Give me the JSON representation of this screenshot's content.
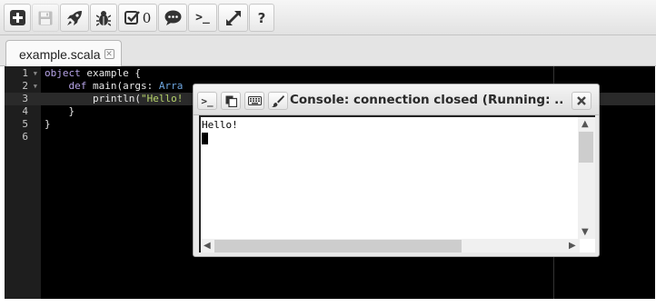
{
  "toolbar": {
    "buttons": [
      {
        "icon": "plus-square-icon"
      },
      {
        "icon": "save-icon",
        "disabled": true
      },
      {
        "icon": "rocket-icon"
      },
      {
        "icon": "bug-icon"
      },
      {
        "icon": "checkbox-icon",
        "count": "0"
      },
      {
        "icon": "speech-bubble-icon"
      },
      {
        "icon": "terminal-icon",
        "text": ">_"
      },
      {
        "icon": "expand-icon"
      },
      {
        "icon": "help-icon",
        "text": "?"
      }
    ]
  },
  "tabs": [
    {
      "label": "example.scala",
      "active": true
    }
  ],
  "editor": {
    "line_numbers": [
      "1",
      "2",
      "3",
      "4",
      "5",
      "6"
    ],
    "active_line": 3,
    "lines": [
      [
        {
          "t": "kw",
          "s": "object"
        },
        {
          "t": "plain",
          "s": " example {"
        }
      ],
      [
        {
          "t": "plain",
          "s": "    "
        },
        {
          "t": "kw",
          "s": "def"
        },
        {
          "t": "plain",
          "s": " main(args: "
        },
        {
          "t": "typ",
          "s": "Arra"
        }
      ],
      [
        {
          "t": "plain",
          "s": "        println("
        },
        {
          "t": "str",
          "s": "\"Hello!"
        }
      ],
      [
        {
          "t": "plain",
          "s": "    }"
        }
      ],
      [
        {
          "t": "plain",
          "s": "}"
        }
      ],
      []
    ]
  },
  "console": {
    "title": "Console: connection closed (Running: ...",
    "output": "Hello!",
    "buttons": {
      "prompt": ">_"
    }
  },
  "colors": {
    "editor_bg": "#000000",
    "keyword": "#b7a4e8",
    "type": "#6ea6e0",
    "string": "#b6d36a"
  }
}
